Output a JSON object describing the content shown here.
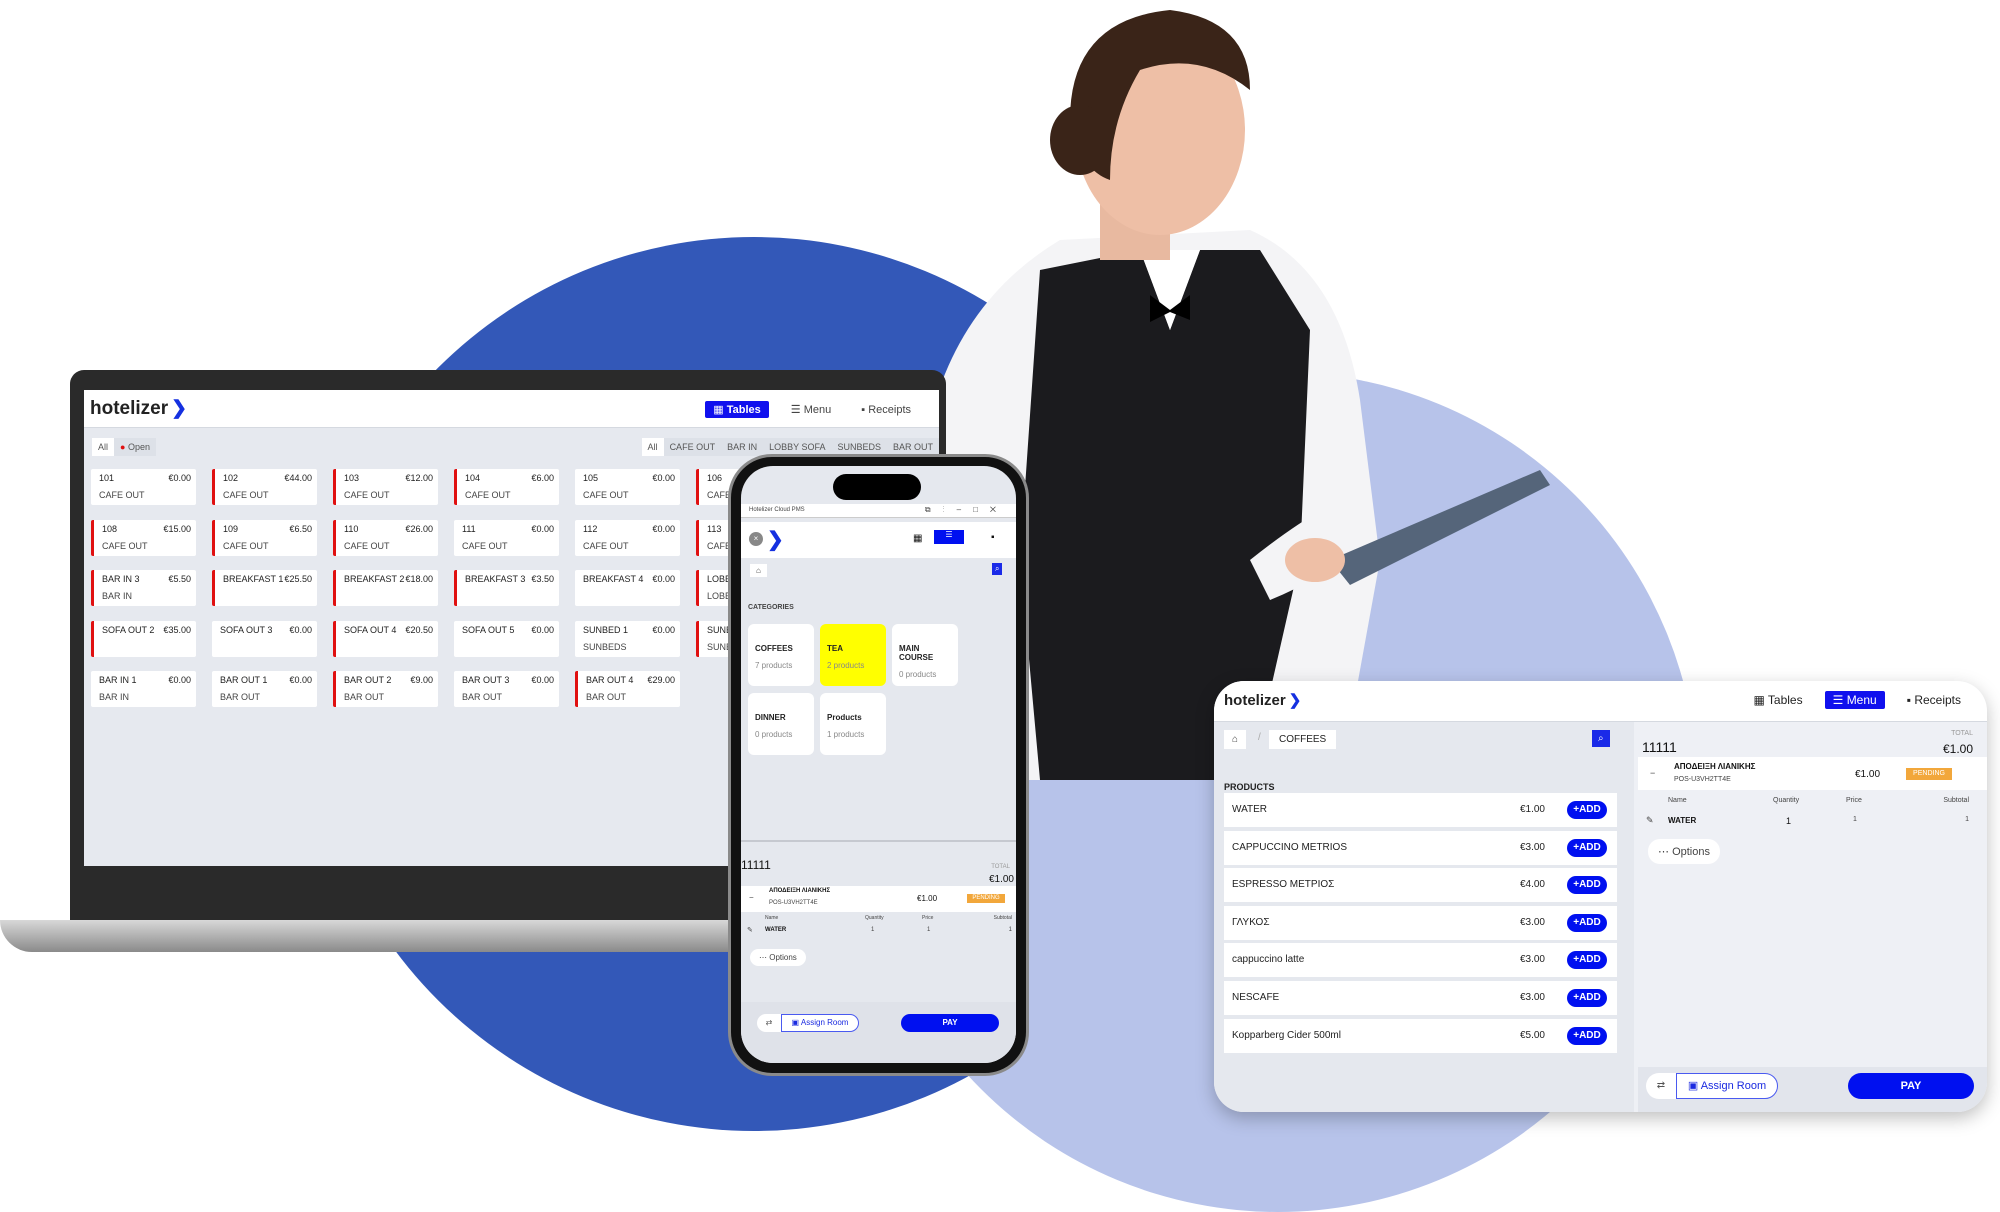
{
  "brand": {
    "name": "hotelizer",
    "accent": "#1010ee",
    "background_circle": "#3358b8",
    "open_marker": "#e01010",
    "tea_highlight": "#ffff00",
    "pending_color": "#f2a73b"
  },
  "laptop": {
    "nav": [
      "Tables",
      "Menu",
      "Receipts"
    ],
    "active_nav": "Tables",
    "status_filter": [
      "All",
      "Open"
    ],
    "area_filter": [
      "All",
      "CAFE OUT",
      "BAR IN",
      "LOBBY SOFA",
      "SUNBEDS",
      "BAR OUT"
    ],
    "tables": [
      [
        {
          "n": "101",
          "p": "€0.00",
          "c": "CAFE OUT",
          "o": false
        },
        {
          "n": "102",
          "p": "€44.00",
          "c": "CAFE OUT",
          "o": true
        },
        {
          "n": "103",
          "p": "€12.00",
          "c": "CAFE OUT",
          "o": true
        },
        {
          "n": "104",
          "p": "€6.00",
          "c": "CAFE OUT",
          "o": true
        },
        {
          "n": "105",
          "p": "€0.00",
          "c": "CAFE OUT",
          "o": false
        },
        {
          "n": "106",
          "p": "",
          "c": "CAFE OUT",
          "o": true
        }
      ],
      [
        {
          "n": "108",
          "p": "€15.00",
          "c": "CAFE OUT",
          "o": true
        },
        {
          "n": "109",
          "p": "€6.50",
          "c": "CAFE OUT",
          "o": true
        },
        {
          "n": "110",
          "p": "€26.00",
          "c": "CAFE OUT",
          "o": true
        },
        {
          "n": "111",
          "p": "€0.00",
          "c": "CAFE OUT",
          "o": false
        },
        {
          "n": "112",
          "p": "€0.00",
          "c": "CAFE OUT",
          "o": false
        },
        {
          "n": "113",
          "p": "",
          "c": "CAFE OUT",
          "o": true
        }
      ],
      [
        {
          "n": "BAR IN 3",
          "p": "€5.50",
          "c": "BAR IN",
          "o": true
        },
        {
          "n": "BREAKFAST 1",
          "p": "€25.50",
          "c": "",
          "o": true
        },
        {
          "n": "BREAKFAST 2",
          "p": "€18.00",
          "c": "",
          "o": true
        },
        {
          "n": "BREAKFAST 3",
          "p": "€3.50",
          "c": "",
          "o": true
        },
        {
          "n": "BREAKFAST 4",
          "p": "€0.00",
          "c": "",
          "o": false
        },
        {
          "n": "LOBBY",
          "p": "",
          "c": "LOBBY",
          "o": true
        }
      ],
      [
        {
          "n": "SOFA OUT 2",
          "p": "€35.00",
          "c": "",
          "o": true
        },
        {
          "n": "SOFA OUT 3",
          "p": "€0.00",
          "c": "",
          "o": false
        },
        {
          "n": "SOFA OUT 4",
          "p": "€20.50",
          "c": "",
          "o": true
        },
        {
          "n": "SOFA OUT 5",
          "p": "€0.00",
          "c": "",
          "o": false
        },
        {
          "n": "SUNBED 1",
          "p": "€0.00",
          "c": "SUNBEDS",
          "o": false
        },
        {
          "n": "SUNB",
          "p": "",
          "c": "SUNB",
          "o": true
        }
      ],
      [
        {
          "n": "BAR IN 1",
          "p": "€0.00",
          "c": "BAR IN",
          "o": false
        },
        {
          "n": "BAR OUT 1",
          "p": "€0.00",
          "c": "BAR OUT",
          "o": false
        },
        {
          "n": "BAR OUT 2",
          "p": "€9.00",
          "c": "BAR OUT",
          "o": true
        },
        {
          "n": "BAR OUT 3",
          "p": "€0.00",
          "c": "BAR OUT",
          "o": false
        },
        {
          "n": "BAR OUT 4",
          "p": "€29.00",
          "c": "BAR OUT",
          "o": true
        }
      ]
    ]
  },
  "phone": {
    "window_title": "Hotelizer Cloud PMS",
    "categories_label": "CATEGORIES",
    "categories": [
      {
        "name": "COFFEES",
        "count": "7 products"
      },
      {
        "name": "TEA",
        "count": "2 products",
        "highlight": true
      },
      {
        "name": "MAIN COURSE",
        "count": "0 products"
      },
      {
        "name": "DINNER",
        "count": "0 products"
      },
      {
        "name": "Products",
        "count": "1 products"
      }
    ]
  },
  "order": {
    "id": "11111",
    "total_label": "TOTAL",
    "total": "€1.00",
    "receipt_title": "ΑΠΟΔΕΙΞΗ ΛΙΑΝΙΚΗΣ",
    "receipt_code": "POS-U3VH2TT4E",
    "receipt_amount": "€1.00",
    "status": "PENDING",
    "columns": [
      "Name",
      "Quantity",
      "Price",
      "Subtotal"
    ],
    "items": [
      {
        "name": "WATER",
        "qty": "1",
        "price": "1",
        "subtotal": "1"
      }
    ],
    "options_label": "Options",
    "assign_label": "Assign Room",
    "pay_label": "PAY"
  },
  "tablet": {
    "nav": [
      "Tables",
      "Menu",
      "Receipts"
    ],
    "active_nav": "Menu",
    "breadcrumb": "COFFEES",
    "products_label": "PRODUCTS",
    "add_label": "ADD",
    "products": [
      {
        "name": "WATER",
        "price": "€1.00"
      },
      {
        "name": "CAPPUCCINO METRIOS",
        "price": "€3.00"
      },
      {
        "name": "ESPRESSO ΜΕΤΡΙΟΣ",
        "price": "€4.00"
      },
      {
        "name": "ΓΛΥΚΟΣ",
        "price": "€3.00"
      },
      {
        "name": "cappuccino latte",
        "price": "€3.00"
      },
      {
        "name": "NESCAFE",
        "price": "€3.00"
      },
      {
        "name": "Kopparberg Cider 500ml",
        "price": "€5.00"
      }
    ]
  }
}
